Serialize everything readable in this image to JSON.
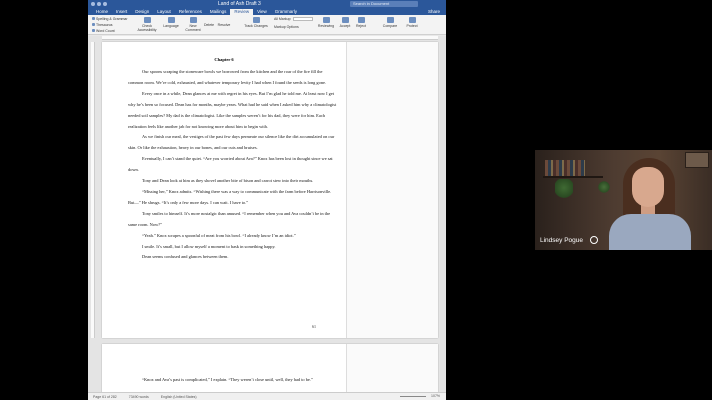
{
  "window": {
    "title": "Land of Ash Draft 3",
    "search_placeholder": "Search in Document"
  },
  "ribbon_tabs": [
    "Home",
    "Insert",
    "Design",
    "Layout",
    "References",
    "Mailings",
    "Review",
    "View",
    "Grammarly"
  ],
  "active_tab": "Review",
  "share_label": "Share",
  "ribbon": {
    "spelling": "Spelling & Grammar",
    "thesaurus": "Thesaurus",
    "word_count": "Word Count",
    "check_accessibility": "Check Accessibility",
    "language": "Language",
    "new_comment": "New Comment",
    "delete": "Delete",
    "resolve": "Resolve",
    "track_changes": "Track Changes",
    "all_markup": "All Markup",
    "markup_options": "Markup Options",
    "reviewing": "Reviewing",
    "accept": "Accept",
    "reject": "Reject",
    "compare": "Compare",
    "protect": "Protect"
  },
  "document": {
    "chapter_title": "Chapter 6",
    "page1_paragraphs": [
      "Our spoons scraping the stoneware bowls we borrowed from the kitchen and the roar of the fire fill the common room. We’re cold, exhausted, and whatever temporary levity I had when I found the seeds is long gone.",
      "Every once in a while, Dean glances at me with regret in his eyes. But I’m glad he told me. At least now I get why he’s been so focused. Dean has for months, maybe years. What had he said when I asked him why a climatologist needed soil samples? My dad is the climatologist. Like the samples weren’t for his dad, they were for him. Each realization feels like another jab for not knowing more about him to begin with.",
      "As we finish our meal, the vestiges of the past few days permeate our silence like the dirt accumulated on our skin. Or like the exhaustion, heavy in our bones, and our cuts and bruises.",
      "Eventually, I can’t stand the quiet. “Are you worried about Ava?” Knox has been lost in thought since we sat down.",
      "Tony and Dean look at him as they shovel another bite of bison and carrot stew into their mouths.",
      "“Missing her,” Knox admits. “Wishing there was a way to communicate with the farm before Harrisonville. But—” He shrugs. “It’s only a few more days. I can wait. I have to.”",
      "Tony smiles to himself. It’s more nostalgic than amused. “I remember when you and Ava couldn’t be in the same room. Now?”",
      "“Yeah.” Knox scrapes a spoonful of meat from his bowl. “I already know I’m an idiot.”",
      "I smile. It’s small, but I allow myself a moment to bask in something happy.",
      "Dean seems confused and glances between them."
    ],
    "page_number": "61",
    "page2_paragraphs": [
      "“Knox and Ava’s past is complicated,” I explain. “They weren’t close until, well, they had to be.”"
    ]
  },
  "status": {
    "page": "Page 61 of 282",
    "words": "73490 words",
    "language": "English (United States)",
    "zoom": "107%"
  },
  "video": {
    "participant_name": "Lindsey Pogue"
  }
}
